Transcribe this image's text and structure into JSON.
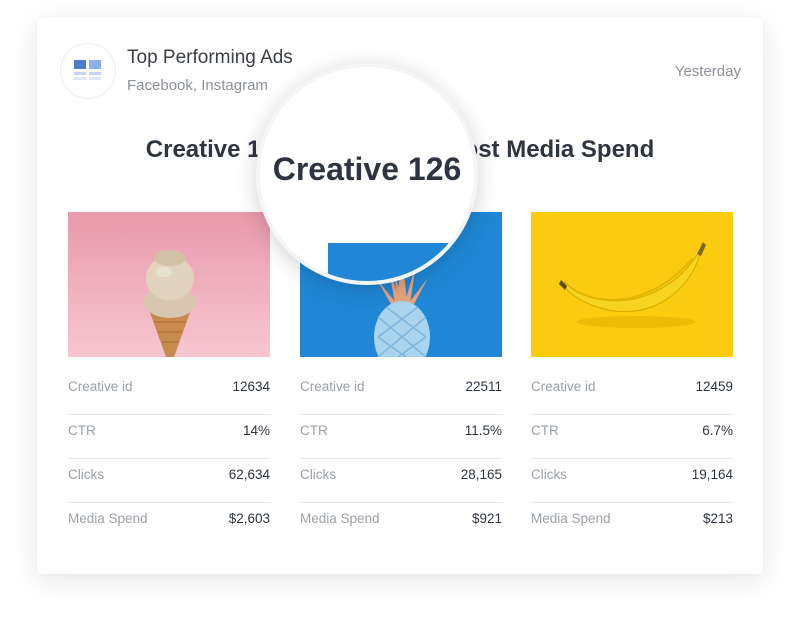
{
  "header": {
    "title": "Top Performing Ads",
    "subtitle": "Facebook, Instagram",
    "date": "Yesterday",
    "logo_icon": "grid-icon",
    "logo_color": "#4f7ac9"
  },
  "headline": "Creative 126     most Media Spend",
  "magnifier": {
    "text": "Creative 126"
  },
  "creatives": [
    {
      "image": "ice-cream-cone",
      "image_bg": "#f2b6c4",
      "stats": [
        {
          "label": "Creative id",
          "value": "12634"
        },
        {
          "label": "CTR",
          "value": "14%"
        },
        {
          "label": "Clicks",
          "value": "62,634"
        },
        {
          "label": "Media Spend",
          "value": "$2,603"
        }
      ]
    },
    {
      "image": "pineapple",
      "image_bg": "#1f87d6",
      "stats": [
        {
          "label": "Creative id",
          "value": "22511"
        },
        {
          "label": "CTR",
          "value": "11.5%"
        },
        {
          "label": "Clicks",
          "value": "28,165"
        },
        {
          "label": "Media Spend",
          "value": "$921"
        }
      ]
    },
    {
      "image": "banana",
      "image_bg": "#fbcb0f",
      "stats": [
        {
          "label": "Creative id",
          "value": "12459"
        },
        {
          "label": "CTR",
          "value": "6.7%"
        },
        {
          "label": "Clicks",
          "value": "19,164"
        },
        {
          "label": "Media Spend",
          "value": "$213"
        }
      ]
    }
  ]
}
